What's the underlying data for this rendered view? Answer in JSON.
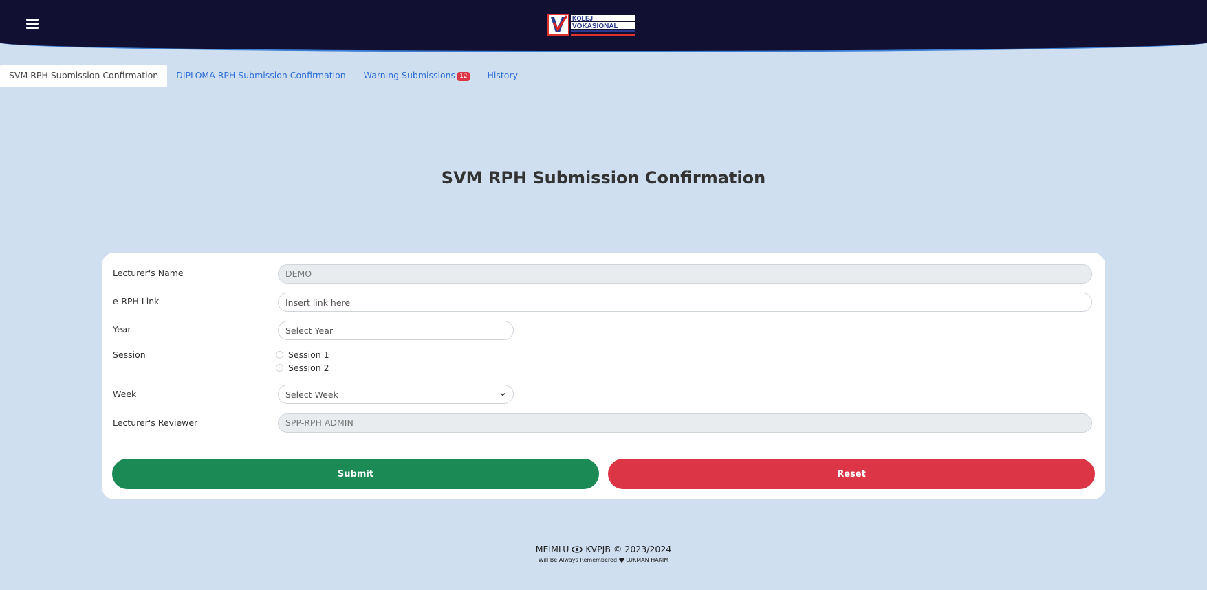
{
  "header": {
    "menu_icon": "hamburger-icon",
    "logo_text": "KOLEJ VOKASIONAL"
  },
  "tabs": [
    {
      "label": "SVM RPH Submission Confirmation",
      "active": true
    },
    {
      "label": "DIPLOMA RPH Submission Confirmation",
      "active": false
    },
    {
      "label": "Warning Submissions",
      "badge": "12",
      "active": false
    },
    {
      "label": "History",
      "active": false
    }
  ],
  "page": {
    "title": "SVM RPH Submission Confirmation"
  },
  "form": {
    "lecturer_name": {
      "label": "Lecturer's Name",
      "value": "DEMO"
    },
    "erph_link": {
      "label": "e-RPH Link",
      "placeholder": "Insert link here"
    },
    "year": {
      "label": "Year",
      "placeholder": "Select Year"
    },
    "session": {
      "label": "Session",
      "options": [
        "Session 1",
        "Session 2"
      ]
    },
    "week": {
      "label": "Week",
      "selected": "Select Week"
    },
    "reviewer": {
      "label": "Lecturer's Reviewer",
      "value": "SPP-RPH ADMIN"
    },
    "submit_label": "Submit",
    "reset_label": "Reset"
  },
  "footer": {
    "left_text": "MEIMLU",
    "right_text": "KVPJB © 2023/2024",
    "tagline_left": "Will Be Always Remembered",
    "tagline_right": "LUKMAN HAKIM"
  },
  "colors": {
    "header_bg": "#111033",
    "page_bg": "#cfdff0",
    "submit": "#1b8a54",
    "reset": "#dc3545",
    "tab_link": "#2e6fd6",
    "badge": "#dc3545"
  }
}
